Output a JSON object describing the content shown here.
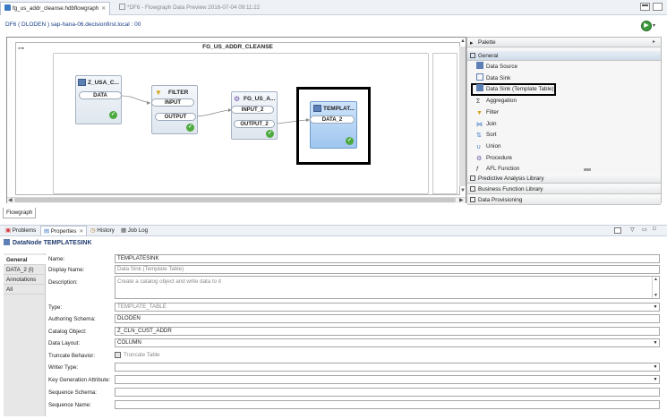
{
  "editor_tabs": [
    {
      "label": "fg_us_addr_cleanse.hdbflowgraph",
      "active": true
    },
    {
      "label": "*DF6 - Flowgraph Data Preview 2016-07-04 09:11:22",
      "active": false
    }
  ],
  "subtitle": "DF6 ( DLODEN )    sap-hana-06.decisionfirst.local : 00",
  "flowgraph": {
    "title": "FG_US_ADDR_CLEANSE",
    "nodes": [
      {
        "title": "Z_USA_C...",
        "ports": [
          "DATA"
        ]
      },
      {
        "title": "FILTER",
        "ports": [
          "INPUT",
          "OUTPUT"
        ]
      },
      {
        "title": "FG_US_A...",
        "ports": [
          "INPUT_2",
          "OUTPUT_2"
        ]
      },
      {
        "title": "TEMPLAT...",
        "ports": [
          "DATA_2"
        ]
      }
    ]
  },
  "palette": {
    "title": "Palette",
    "drawer_general": "General",
    "items": [
      {
        "label": "Data Source",
        "icon": "table-icon"
      },
      {
        "label": "Data Sink",
        "icon": "sink-icon"
      },
      {
        "label": "Data Sink (Template Table)",
        "icon": "table-icon"
      },
      {
        "label": "Aggregation",
        "icon": "sigma-icon"
      },
      {
        "label": "Filter",
        "icon": "funnel-icon"
      },
      {
        "label": "Join",
        "icon": "join-icon"
      },
      {
        "label": "Sort",
        "icon": "sort-icon"
      },
      {
        "label": "Union",
        "icon": "union-icon"
      },
      {
        "label": "Procedure",
        "icon": "procedure-icon"
      },
      {
        "label": "AFL Function",
        "icon": "function-icon"
      }
    ],
    "drawers": [
      "Predictive Analysis Library",
      "Business Function Library",
      "Data Provisioning"
    ]
  },
  "flowgraph_tab": "Flowgraph",
  "views": {
    "tabs": [
      "Problems",
      "Properties",
      "History",
      "Job Log"
    ],
    "active": "Properties"
  },
  "properties": {
    "header": "DataNode TEMPLATESINK",
    "side_tabs": [
      "General",
      "DATA_2 (I)",
      "Annotations",
      "All"
    ],
    "fields": {
      "name": {
        "label": "Name:",
        "value": "TEMPLATESINK"
      },
      "display_name": {
        "label": "Display Name:",
        "value": "Data Sink (Template Table)"
      },
      "description": {
        "label": "Description:",
        "value": "Create a catalog object and write data to it"
      },
      "type": {
        "label": "Type:",
        "value": "TEMPLATE_TABLE"
      },
      "authoring_schema": {
        "label": "Authoring Schema:",
        "value": "DLODEN"
      },
      "catalog_object": {
        "label": "Catalog Object:",
        "value": "Z_CLN_CUST_ADDR"
      },
      "data_layout": {
        "label": "Data Layout:",
        "value": "COLUMN"
      },
      "truncate_behavior": {
        "label": "Truncate Behavior:",
        "value": "Truncate Table"
      },
      "writer_type": {
        "label": "Writer Type:",
        "value": ""
      },
      "key_generation": {
        "label": "Key Generation Attribute:",
        "value": ""
      },
      "sequence_schema": {
        "label": "Sequence Schema:",
        "value": ""
      },
      "sequence_name": {
        "label": "Sequence Name:",
        "value": ""
      }
    }
  }
}
